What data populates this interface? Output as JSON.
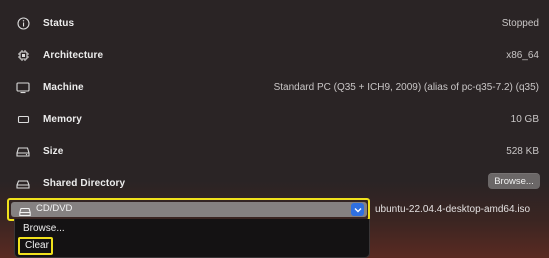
{
  "rows": [
    {
      "label": "Status",
      "value": "Stopped",
      "icon": "info-circle-icon"
    },
    {
      "label": "Architecture",
      "value": "x86_64",
      "icon": "cpu-icon"
    },
    {
      "label": "Machine",
      "value": "Standard PC (Q35 + ICH9, 2009) (alias of pc-q35-7.2) (q35)",
      "icon": "display-icon"
    },
    {
      "label": "Memory",
      "value": "10 GB",
      "icon": "memory-icon"
    },
    {
      "label": "Size",
      "value": "528 KB",
      "icon": "disk-icon"
    },
    {
      "label": "Shared Directory",
      "value": "",
      "icon": "folder-drive-icon"
    }
  ],
  "shared_directory": {
    "browse_label": "Browse..."
  },
  "cd_dvd": {
    "label": "CD/DVD",
    "icon": "drive-icon",
    "iso": "ubuntu-22.04.4-desktop-amd64.iso",
    "menu": {
      "browse": "Browse...",
      "clear": "Clear"
    }
  },
  "colors": {
    "highlight": "#f0e11c",
    "accent": "#2f6fe0"
  }
}
